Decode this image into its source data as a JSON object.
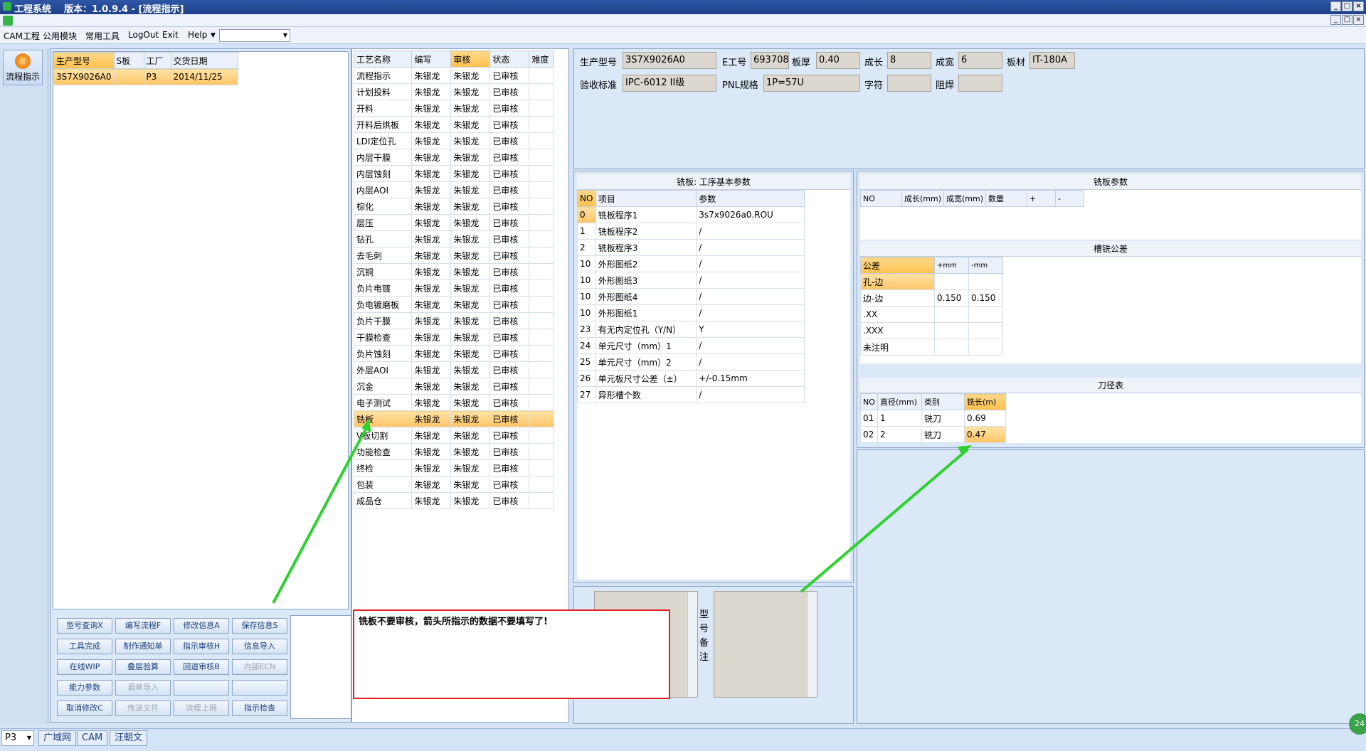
{
  "titlebar": {
    "text": "工程系统    版本：1.0.9.4 - [流程指示]",
    "min": "_",
    "max": "□",
    "close": "×",
    "min2": "_",
    "max2": "□",
    "close2": "×"
  },
  "menu": [
    "CAM工程",
    "公用模块",
    "常用工具",
    "LogOut",
    "Exit",
    "Help"
  ],
  "sidebar": {
    "flow_label": "流程指示"
  },
  "order_table": {
    "headers": [
      "生产型号",
      "S板",
      "工厂",
      "交货日期"
    ],
    "rows": [
      [
        "3S7X9026A0",
        "",
        "P3",
        "2014/11/25"
      ]
    ]
  },
  "process_table": {
    "headers": [
      "工艺名称",
      "编写",
      "审核",
      "状态",
      "难度"
    ],
    "rows": [
      [
        "流程指示",
        "朱银龙",
        "朱银龙",
        "已审核",
        ""
      ],
      [
        "计划投料",
        "朱银龙",
        "朱银龙",
        "已审核",
        ""
      ],
      [
        "开料",
        "朱银龙",
        "朱银龙",
        "已审核",
        ""
      ],
      [
        "开料后烘板",
        "朱银龙",
        "朱银龙",
        "已审核",
        ""
      ],
      [
        "LDI定位孔",
        "朱银龙",
        "朱银龙",
        "已审核",
        ""
      ],
      [
        "内层干膜",
        "朱银龙",
        "朱银龙",
        "已审核",
        ""
      ],
      [
        "内层蚀刻",
        "朱银龙",
        "朱银龙",
        "已审核",
        ""
      ],
      [
        "内层AOI",
        "朱银龙",
        "朱银龙",
        "已审核",
        ""
      ],
      [
        "棕化",
        "朱银龙",
        "朱银龙",
        "已审核",
        ""
      ],
      [
        "层压",
        "朱银龙",
        "朱银龙",
        "已审核",
        ""
      ],
      [
        "钻孔",
        "朱银龙",
        "朱银龙",
        "已审核",
        ""
      ],
      [
        "去毛刺",
        "朱银龙",
        "朱银龙",
        "已审核",
        ""
      ],
      [
        "沉铜",
        "朱银龙",
        "朱银龙",
        "已审核",
        ""
      ],
      [
        "负片电镀",
        "朱银龙",
        "朱银龙",
        "已审核",
        ""
      ],
      [
        "负电镀磨板",
        "朱银龙",
        "朱银龙",
        "已审核",
        ""
      ],
      [
        "负片干膜",
        "朱银龙",
        "朱银龙",
        "已审核",
        ""
      ],
      [
        "干膜检查",
        "朱银龙",
        "朱银龙",
        "已审核",
        ""
      ],
      [
        "负片蚀刻",
        "朱银龙",
        "朱银龙",
        "已审核",
        ""
      ],
      [
        "外层AOI",
        "朱银龙",
        "朱银龙",
        "已审核",
        ""
      ],
      [
        "沉金",
        "朱银龙",
        "朱银龙",
        "已审核",
        ""
      ],
      [
        "电子测试",
        "朱银龙",
        "朱银龙",
        "已审核",
        ""
      ],
      [
        "铣板",
        "朱银龙",
        "朱银龙",
        "已审核",
        ""
      ],
      [
        "V板切割",
        "朱银龙",
        "朱银龙",
        "已审核",
        ""
      ],
      [
        "功能检查",
        "朱银龙",
        "朱银龙",
        "已审核",
        ""
      ],
      [
        "终检",
        "朱银龙",
        "朱银龙",
        "已审核",
        ""
      ],
      [
        "包装",
        "朱银龙",
        "朱银龙",
        "已审核",
        ""
      ],
      [
        "成品仓",
        "朱银龙",
        "朱银龙",
        "已审核",
        ""
      ]
    ],
    "selected_index": 21
  },
  "buttons": [
    [
      "型号查询X",
      "编写流程F",
      "修改信息A",
      "保存信息S"
    ],
    [
      "工具完成",
      "制作通知单",
      "指示审核H",
      "信息导入"
    ],
    [
      "在线WIP",
      "叠层验算",
      "回退审核B",
      "内部ECN"
    ],
    [
      "能力参数",
      "调单导入",
      "",
      ""
    ],
    [
      "取消修改C",
      "传送文件",
      "流程上网",
      "指示检查"
    ]
  ],
  "disabled_buttons": [
    "内部ECN",
    "调单导入",
    "传送文件",
    "流程上网"
  ],
  "header_fields": {
    "model_label": "生产型号",
    "model": "3S7X9026A0",
    "eno_label": "E工号",
    "eno": "693708",
    "thick_label": "板厚",
    "thick": "0.40",
    "len_label": "成长",
    "len": "8",
    "wid_label": "成宽",
    "wid": "6",
    "mat_label": "板材",
    "mat": "IT-180A",
    "std_label": "验收标准",
    "std": "IPC-6012 II级",
    "pnl_label": "PNL规格",
    "pnl": "1P=57U",
    "char_label": "字符",
    "char": "",
    "mask_label": "阻焊",
    "mask": ""
  },
  "basic_params": {
    "title": "铣板: 工序基本参数",
    "headers": [
      "NO",
      "项目",
      "参数"
    ],
    "rows": [
      [
        "0",
        "铣板程序1",
        "3s7x9026a0.ROU"
      ],
      [
        "1",
        "铣板程序2",
        "/"
      ],
      [
        "2",
        "铣板程序3",
        "/"
      ],
      [
        "10",
        "外形图纸2",
        "/"
      ],
      [
        "10",
        "外形图纸3",
        "/"
      ],
      [
        "10",
        "外形图纸4",
        "/"
      ],
      [
        "10",
        "外形图纸1",
        "/"
      ],
      [
        "23",
        "有无内定位孔（Y/N）",
        "Y"
      ],
      [
        "24",
        "单元尺寸（mm）1",
        "/"
      ],
      [
        "25",
        "单元尺寸（mm）2",
        "/"
      ],
      [
        "26",
        "单元板尺寸公差（±）",
        "+/-0.15mm"
      ],
      [
        "27",
        "异形槽个数",
        "/"
      ]
    ]
  },
  "mill_params": {
    "title": "铣板参数",
    "headers": [
      "NO",
      "成长(mm)",
      "成宽(mm)",
      "数量",
      "+",
      "-"
    ]
  },
  "tolerance": {
    "title": "槽铣公差",
    "headers": [
      "公差",
      "+mm",
      "-mm"
    ],
    "rows": [
      [
        "孔-边",
        "",
        ""
      ],
      [
        "边-边",
        "0.150",
        "0.150"
      ],
      [
        ".XX",
        "",
        ""
      ],
      [
        ".XXX",
        "",
        ""
      ],
      [
        "未注明",
        "",
        ""
      ]
    ]
  },
  "tools": {
    "title": "刀径表",
    "headers": [
      "NO",
      "直径(mm)",
      "类别",
      "铣长(m)"
    ],
    "rows": [
      [
        "01",
        "1",
        "铣刀",
        "0.69"
      ],
      [
        "02",
        "2",
        "铣刀",
        "0.47"
      ]
    ]
  },
  "remark_label": [
    "型",
    "号",
    "备",
    "注"
  ],
  "annotation": "铣板不要审核，箭头所指示的数据不要填写了!",
  "statusbar": {
    "factory": "P3",
    "tabs": [
      "广域网",
      "CAM",
      "汪朝文"
    ],
    "clock": "24"
  }
}
